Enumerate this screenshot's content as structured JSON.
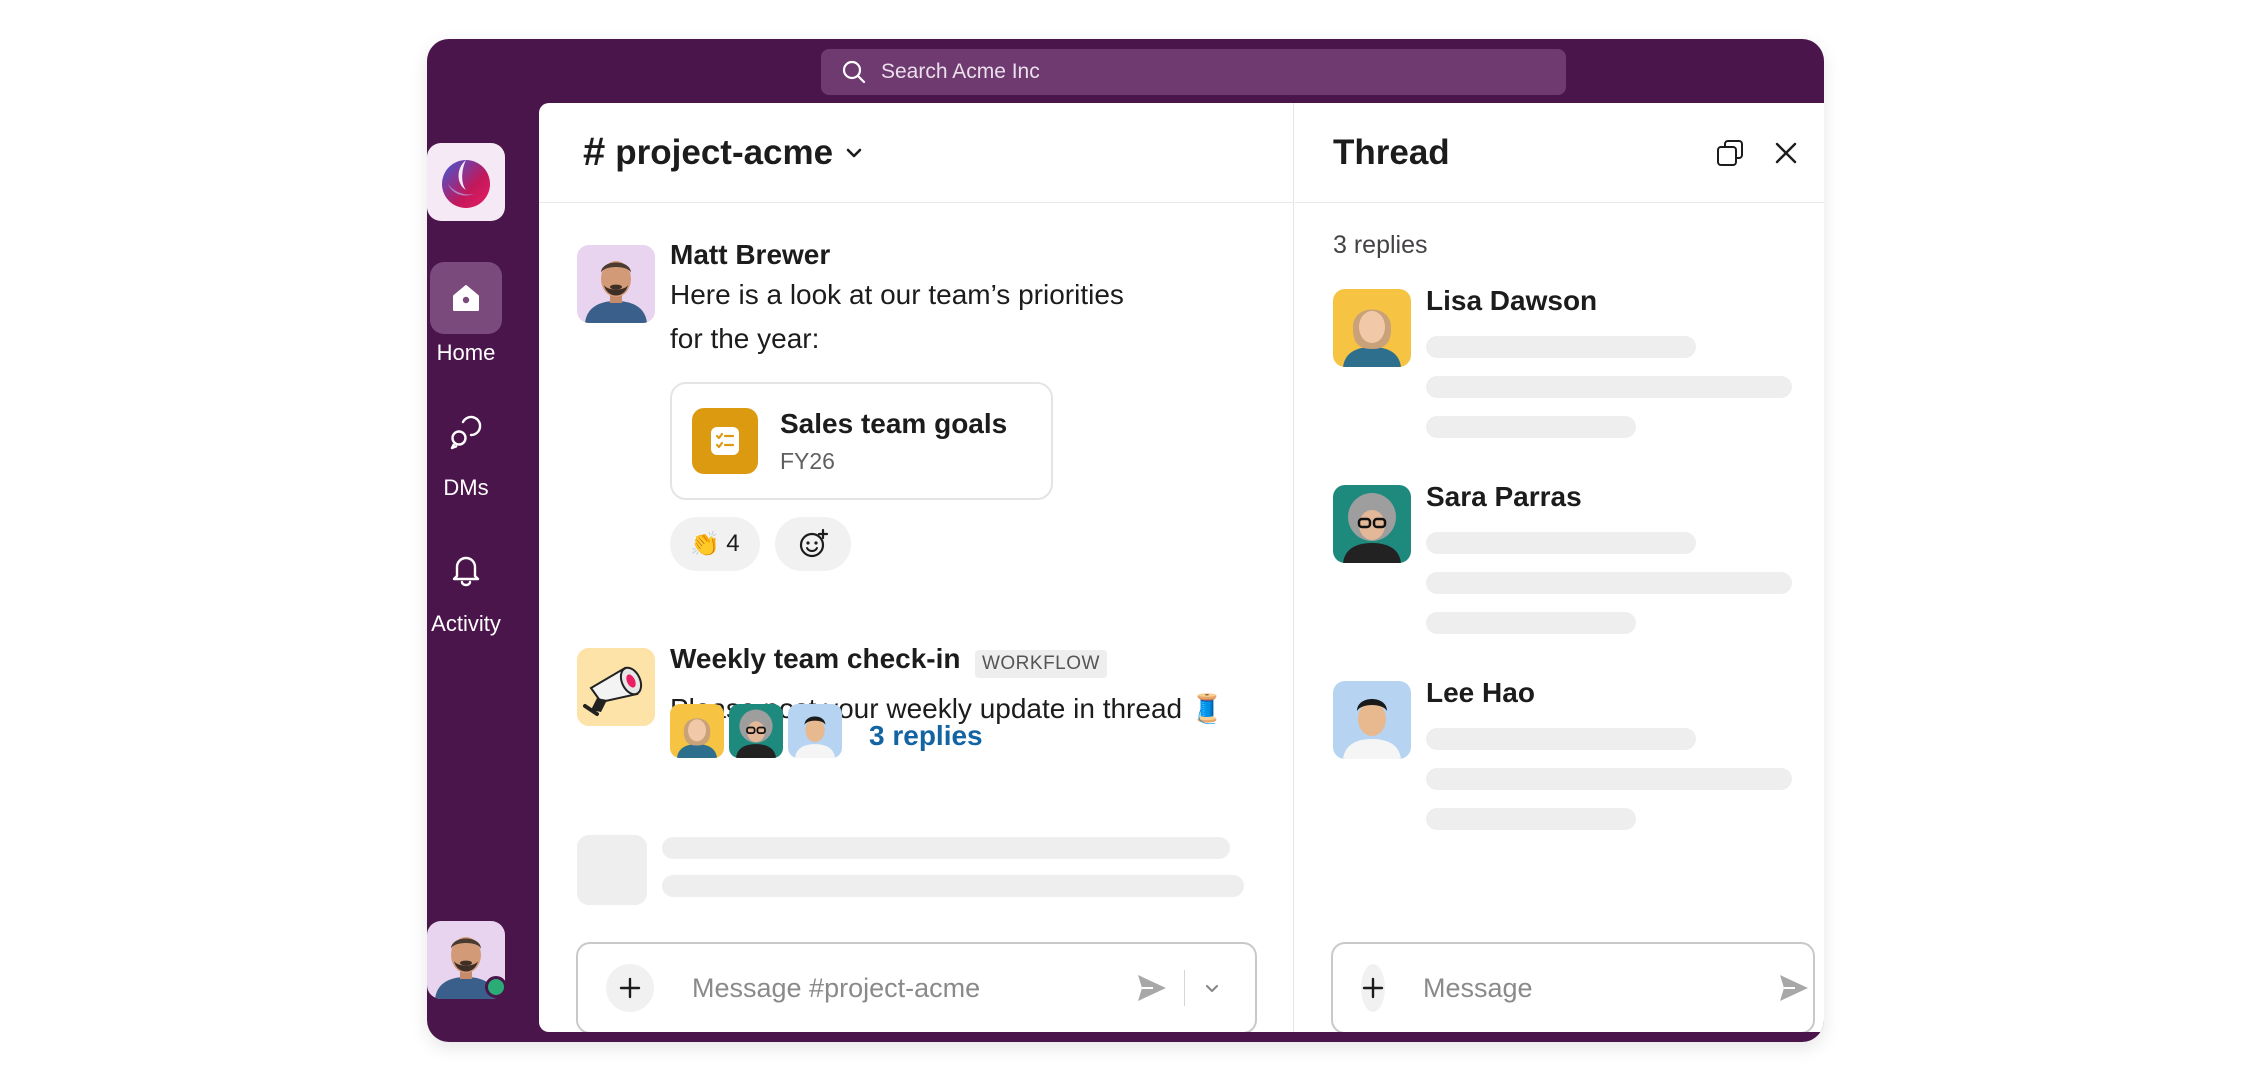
{
  "search": {
    "placeholder": "Search Acme Inc"
  },
  "rail": {
    "items": [
      {
        "label": "Home",
        "icon": "home-icon",
        "active": true
      },
      {
        "label": "DMs",
        "icon": "dms-icon"
      },
      {
        "label": "Activity",
        "icon": "bell-icon"
      }
    ]
  },
  "channel": {
    "name": "project-acme",
    "messages": [
      {
        "sender": "Matt Brewer",
        "text_line1": "Here is a look at our team’s priorities",
        "text_line2": "for the year:",
        "file": {
          "title": "Sales team goals",
          "subtitle": "FY26"
        },
        "reaction": {
          "emoji": "👏",
          "count": "4"
        }
      },
      {
        "sender": "Weekly team check-in",
        "badge": "WORKFLOW",
        "text": "Please post your weekly update in thread 🧵",
        "replies_label": "3 replies"
      }
    ],
    "composer_placeholder": "Message #project-acme"
  },
  "thread": {
    "title": "Thread",
    "reply_count": "3 replies",
    "replies": [
      {
        "sender": "Lisa Dawson"
      },
      {
        "sender": "Sara Parras"
      },
      {
        "sender": "Lee Hao"
      }
    ],
    "composer_placeholder": "Message"
  },
  "colors": {
    "aubergine": "#4a154b",
    "link": "#1264a3",
    "presence": "#2bac76",
    "file_icon": "#dc9a11"
  }
}
